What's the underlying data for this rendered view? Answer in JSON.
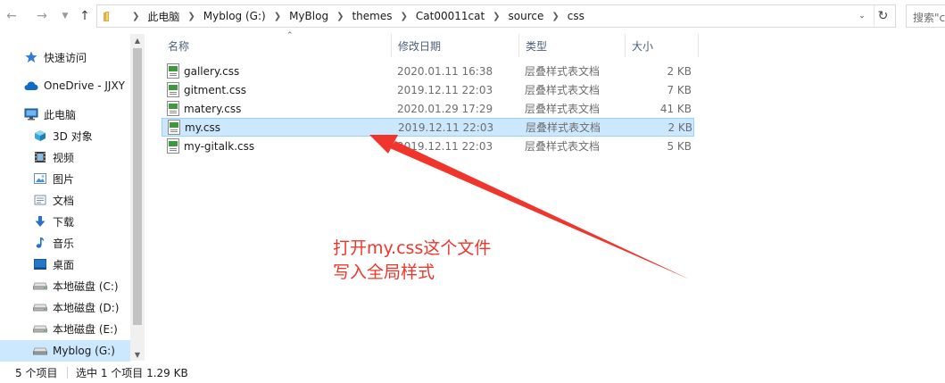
{
  "address": {
    "breadcrumbs": [
      "此电脑",
      "Myblog (G:)",
      "MyBlog",
      "themes",
      "Cat00011cat",
      "source",
      "css"
    ],
    "search_placeholder": "搜索\"c"
  },
  "sidebar": {
    "items": [
      {
        "label": "快速访问",
        "icon": "star-icon"
      },
      {
        "label": "OneDrive - JJXY",
        "icon": "cloud-icon"
      },
      {
        "label": "此电脑",
        "icon": "computer-icon"
      },
      {
        "label": "3D 对象",
        "icon": "cube-3d-icon"
      },
      {
        "label": "视频",
        "icon": "video-icon"
      },
      {
        "label": "图片",
        "icon": "picture-icon"
      },
      {
        "label": "文档",
        "icon": "document-icon"
      },
      {
        "label": "下载",
        "icon": "download-icon"
      },
      {
        "label": "音乐",
        "icon": "music-icon"
      },
      {
        "label": "桌面",
        "icon": "desktop-icon"
      },
      {
        "label": "本地磁盘 (C:)",
        "icon": "drive-icon"
      },
      {
        "label": "本地磁盘 (D:)",
        "icon": "drive-icon"
      },
      {
        "label": "本地磁盘 (E:)",
        "icon": "drive-icon"
      },
      {
        "label": "Myblog (G:)",
        "icon": "drive-icon"
      }
    ]
  },
  "columns": {
    "name": "名称",
    "date": "修改日期",
    "type": "类型",
    "size": "大小"
  },
  "files": [
    {
      "name": "gallery.css",
      "date": "2020.01.11 16:38",
      "type": "层叠样式表文档",
      "size": "2 KB"
    },
    {
      "name": "gitment.css",
      "date": "2019.12.11 22:03",
      "type": "层叠样式表文档",
      "size": "7 KB"
    },
    {
      "name": "matery.css",
      "date": "2020.01.29 17:29",
      "type": "层叠样式表文档",
      "size": "41 KB"
    },
    {
      "name": "my.css",
      "date": "2019.12.11 22:03",
      "type": "层叠样式表文档",
      "size": "2 KB"
    },
    {
      "name": "my-gitalk.css",
      "date": "2019.12.11 22:03",
      "type": "层叠样式表文档",
      "size": "5 KB"
    }
  ],
  "annotation": {
    "line1": "打开my.css这个文件",
    "line2": "写入全局样式",
    "color": "#f0352c"
  },
  "status": {
    "item_count": "5 个项目",
    "selection": "选中 1 个项目 1.29 KB"
  },
  "colors": {
    "selection_bg": "#cce8ff",
    "selection_border": "#99d1ff",
    "header_text": "#4c607a"
  }
}
